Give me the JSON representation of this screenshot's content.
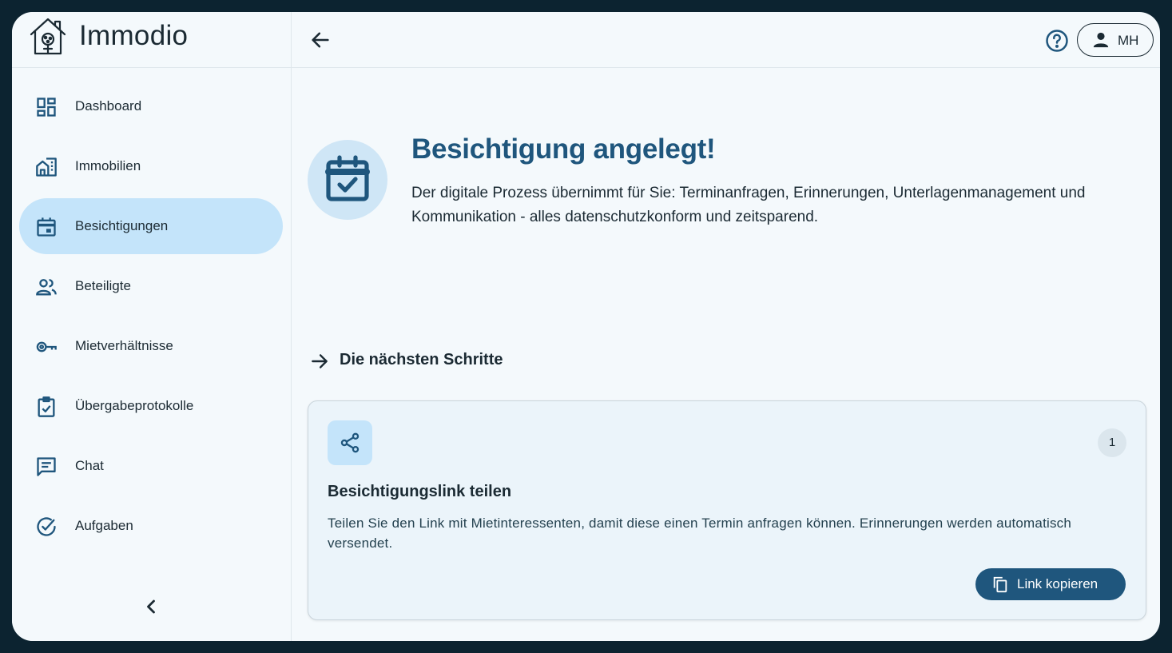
{
  "app": {
    "name": "Immodio"
  },
  "sidebar": {
    "items": [
      {
        "label": "Dashboard",
        "icon": "dashboard-icon",
        "active": false
      },
      {
        "label": "Immobilien",
        "icon": "building-icon",
        "active": false
      },
      {
        "label": "Besichtigungen",
        "icon": "calendar-icon",
        "active": true
      },
      {
        "label": "Beteiligte",
        "icon": "people-icon",
        "active": false
      },
      {
        "label": "Mietverhältnisse",
        "icon": "key-icon",
        "active": false
      },
      {
        "label": "Übergabeprotokolle",
        "icon": "clipboard-check-icon",
        "active": false
      },
      {
        "label": "Chat",
        "icon": "chat-icon",
        "active": false
      },
      {
        "label": "Aufgaben",
        "icon": "check-circle-icon",
        "active": false
      }
    ],
    "collapse_icon": "chevron-left-icon"
  },
  "topbar": {
    "back_icon": "arrow-left-icon",
    "help_icon": "help-circle-icon",
    "user_initials": "MH"
  },
  "hero": {
    "title": "Besichtigung angelegt!",
    "description": "Der digitale Prozess übernimmt für Sie: Terminanfragen, Erinnerungen, Unterlagenmanagement und Kommunikation - alles datenschutzkonform und zeitsparend."
  },
  "next_steps": {
    "title": "Die nächsten Schritte",
    "steps": [
      {
        "number": "1",
        "icon": "share-icon",
        "title": "Besichtigungslink teilen",
        "description": "Teilen Sie den Link mit Mietinteressenten, damit diese einen Termin anfragen können. Erinnerungen werden automatisch versendet.",
        "button_label": "Link kopieren"
      }
    ]
  },
  "colors": {
    "accent": "#1f567d",
    "active_nav": "#c4e4fa",
    "background": "#f4f9fc",
    "frame": "#0c2330"
  }
}
